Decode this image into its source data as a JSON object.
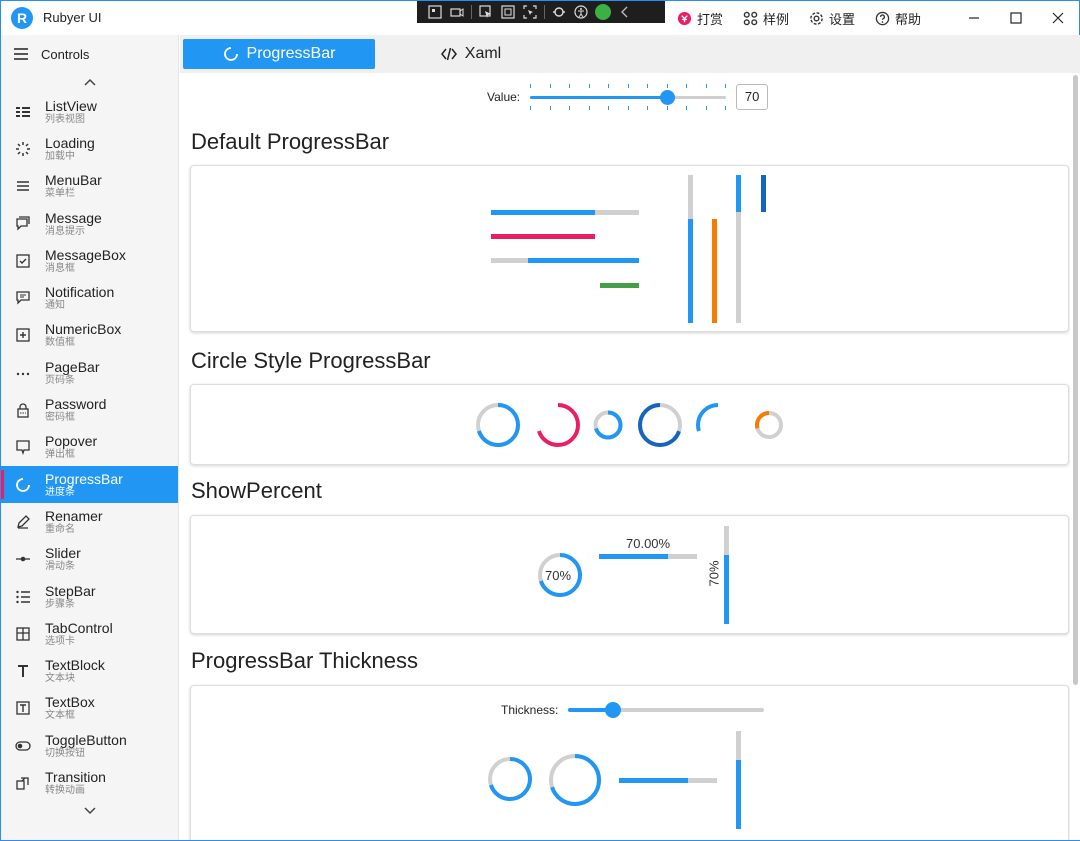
{
  "app": {
    "title": "Rubyer UI",
    "logo_letter": "R"
  },
  "titlebar": {
    "actions": [
      {
        "label": "打赏",
        "icon": "donate-icon"
      },
      {
        "label": "样例",
        "icon": "grid-icon"
      },
      {
        "label": "设置",
        "icon": "gear-icon"
      },
      {
        "label": "帮助",
        "icon": "help-icon"
      }
    ]
  },
  "sidebar": {
    "header": "Controls",
    "items": [
      {
        "label": "ListView",
        "sub": "列表视图",
        "icon": "list-view-icon"
      },
      {
        "label": "Loading",
        "sub": "加载中",
        "icon": "loading-icon"
      },
      {
        "label": "MenuBar",
        "sub": "菜单栏",
        "icon": "menu-icon"
      },
      {
        "label": "Message",
        "sub": "消息提示",
        "icon": "message-icon"
      },
      {
        "label": "MessageBox",
        "sub": "消息框",
        "icon": "messagebox-icon"
      },
      {
        "label": "Notification",
        "sub": "通知",
        "icon": "notification-icon"
      },
      {
        "label": "NumericBox",
        "sub": "数值框",
        "icon": "plus-box-icon"
      },
      {
        "label": "PageBar",
        "sub": "页码条",
        "icon": "dots-icon"
      },
      {
        "label": "Password",
        "sub": "密码框",
        "icon": "lock-icon"
      },
      {
        "label": "Popover",
        "sub": "弹出框",
        "icon": "popover-icon"
      },
      {
        "label": "ProgressBar",
        "sub": "进度条",
        "icon": "progress-icon",
        "active": true
      },
      {
        "label": "Renamer",
        "sub": "重命名",
        "icon": "pencil-icon"
      },
      {
        "label": "Slider",
        "sub": "滑动条",
        "icon": "slider-icon"
      },
      {
        "label": "StepBar",
        "sub": "步骤条",
        "icon": "steps-icon"
      },
      {
        "label": "TabControl",
        "sub": "选项卡",
        "icon": "tabs-icon"
      },
      {
        "label": "TextBlock",
        "sub": "文本块",
        "icon": "text-icon"
      },
      {
        "label": "TextBox",
        "sub": "文本框",
        "icon": "textbox-icon"
      },
      {
        "label": "ToggleButton",
        "sub": "切换按钮",
        "icon": "toggle-icon"
      },
      {
        "label": "Transition",
        "sub": "转换动画",
        "icon": "transition-icon"
      }
    ]
  },
  "tabs": [
    {
      "label": "ProgressBar",
      "icon": "progress-icon",
      "active": true
    },
    {
      "label": "Xaml",
      "icon": "code-icon",
      "active": false
    }
  ],
  "value_control": {
    "label": "Value:",
    "value": "70",
    "fraction": 0.7
  },
  "sections": {
    "default": {
      "title": "Default ProgressBar"
    },
    "circle": {
      "title": "Circle Style ProgressBar"
    },
    "percent": {
      "title": "ShowPercent",
      "circle_text": "70%",
      "bar_text": "70.00%",
      "vertical_text": "70%"
    },
    "thickness": {
      "title": "ProgressBar Thickness",
      "label": "Thickness:",
      "fraction": 0.23
    }
  },
  "colors": {
    "accent": "#2196f3",
    "pink": "#e91e63",
    "orange": "#f57c00",
    "green": "#43a047",
    "dark_blue": "#1565c0",
    "track": "#d0d0d0"
  },
  "progress_values": {
    "default_horizontal": [
      0.7,
      0.7,
      0.75,
      0.7
    ],
    "default_vertical": [
      0.7,
      0.7,
      0.25,
      0.25
    ],
    "circles": [
      0.7,
      0.7,
      0.7,
      0.7,
      0.3,
      0.3
    ],
    "percent": 0.7,
    "thickness_circles": [
      0.7,
      0.7
    ],
    "thickness_bar": 0.7,
    "thickness_vertical": 0.7
  }
}
